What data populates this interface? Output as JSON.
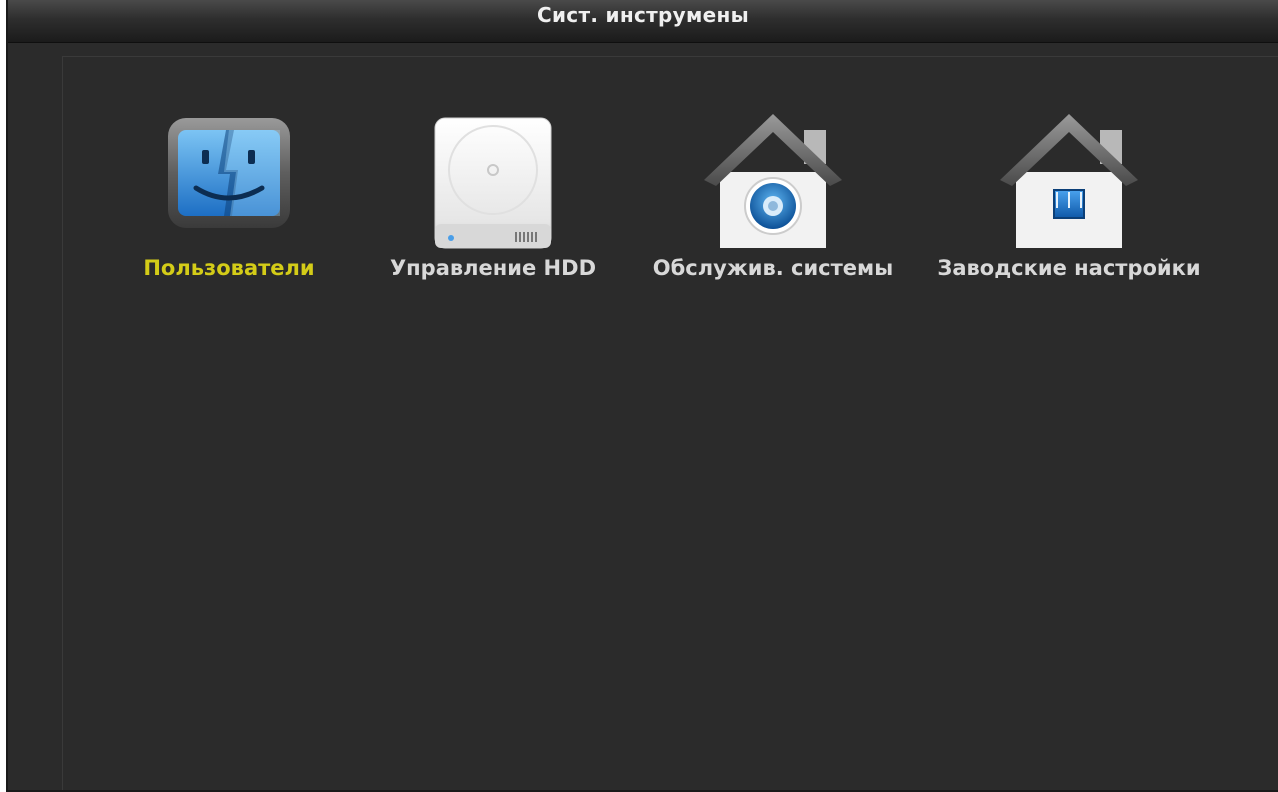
{
  "window": {
    "title": "Сист. инструмены"
  },
  "tools": [
    {
      "label": "Пользователи",
      "icon": "users-finder-icon",
      "selected": true
    },
    {
      "label": "Управление HDD",
      "icon": "hard-drive-icon",
      "selected": false
    },
    {
      "label": "Обслужив. системы",
      "icon": "house-maintenance-icon",
      "selected": false
    },
    {
      "label": "Заводские настройки",
      "icon": "house-factory-reset-icon",
      "selected": false
    }
  ],
  "colors": {
    "selected_label": "#d4cc18",
    "label": "#d8d8d8",
    "background": "#2b2b2b"
  }
}
